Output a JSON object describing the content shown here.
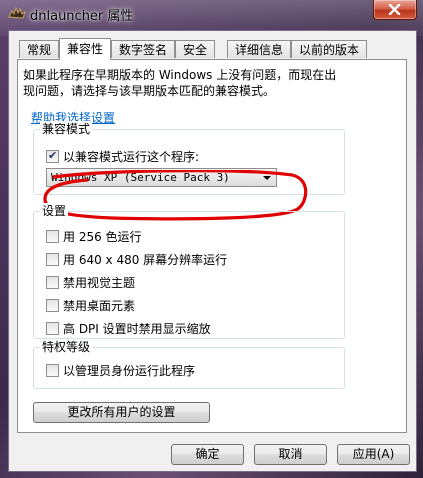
{
  "window": {
    "title": "dnlauncher 属性"
  },
  "tabs": [
    {
      "label": "常规"
    },
    {
      "label": "兼容性"
    },
    {
      "label": "数字签名"
    },
    {
      "label": "安全"
    },
    {
      "label": "详细信息"
    },
    {
      "label": "以前的版本"
    }
  ],
  "active_tab": "兼容性",
  "intro": {
    "line1": "如果此程序在早期版本的 Windows 上没有问题，而现在出",
    "line2": "现问题，请选择与该早期版本匹配的兼容模式。"
  },
  "help_link": "帮助我选择设置",
  "compat_mode": {
    "group_title": "兼容模式",
    "checkbox_label": "以兼容模式运行这个程序:",
    "checked": true,
    "selected_os": "Windows XP (Service Pack 3)"
  },
  "settings": {
    "group_title": "设置",
    "items": [
      {
        "label": "用 256 色运行",
        "checked": false
      },
      {
        "label": "用 640 x 480 屏幕分辨率运行",
        "checked": false
      },
      {
        "label": "禁用视觉主题",
        "checked": false
      },
      {
        "label": "禁用桌面元素",
        "checked": false
      },
      {
        "label": "高 DPI 设置时禁用显示缩放",
        "checked": false
      }
    ]
  },
  "privilege": {
    "group_title": "特权等级",
    "checkbox_label": "以管理员身份运行此程序",
    "checked": false
  },
  "all_users_button": "更改所有用户的设置",
  "buttons": {
    "ok": "确定",
    "cancel": "取消",
    "apply": "应用(A)"
  },
  "colors": {
    "annotation_red": "#e00000",
    "link": "#0066cc"
  }
}
